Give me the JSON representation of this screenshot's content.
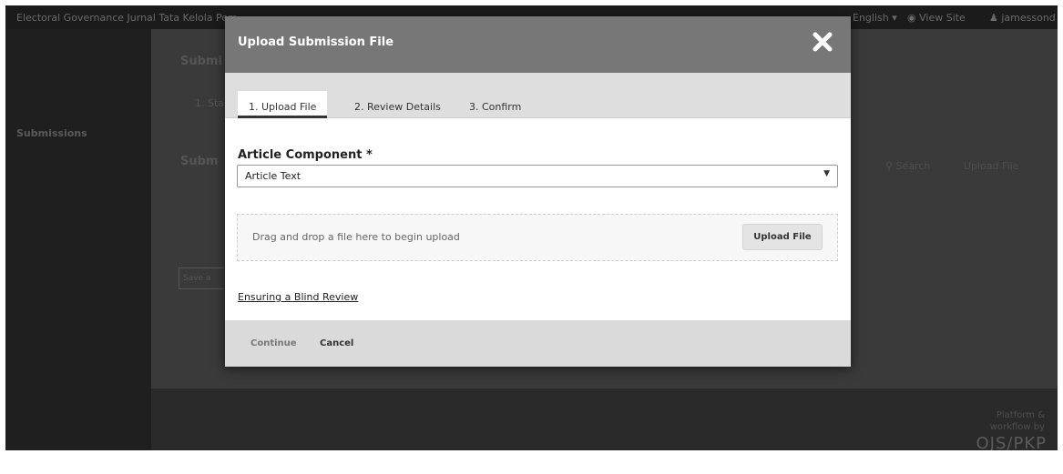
{
  "topbar": {
    "site_title": "Electoral Governance Jurnal Tata Kelola Pem...",
    "language": "English ▾",
    "view_site": "View Site",
    "user": "jamessond"
  },
  "sidebar": {
    "items": [
      {
        "label": "Submissions"
      }
    ]
  },
  "background": {
    "page_title": "Submi",
    "step": "1. Sta",
    "section_title": "Subm",
    "search": "Search",
    "upload_file": "Upload File",
    "save_button": "Save a"
  },
  "footer": {
    "line1": "Platform &",
    "line2": "workflow by",
    "logo": "OJS/PKP"
  },
  "modal": {
    "title": "Upload Submission File",
    "tabs": [
      {
        "label": "1. Upload File",
        "active": true
      },
      {
        "label": "2. Review Details",
        "active": false
      },
      {
        "label": "3. Confirm",
        "active": false
      }
    ],
    "component_label": "Article Component *",
    "component_value": "Article Text",
    "dropzone_text": "Drag and drop a file here to begin upload",
    "upload_button": "Upload File",
    "blind_review_link": "Ensuring a Blind Review",
    "continue_button": "Continue",
    "cancel_button": "Cancel"
  },
  "colors": {
    "modal_header": "#777777",
    "overlay": "#2b2b2b",
    "tab_bar": "#dedede",
    "footer_bar": "#dadada"
  },
  "icons": {
    "close": "close-icon",
    "search": "search-icon",
    "eye": "eye-icon",
    "user": "user-icon"
  }
}
